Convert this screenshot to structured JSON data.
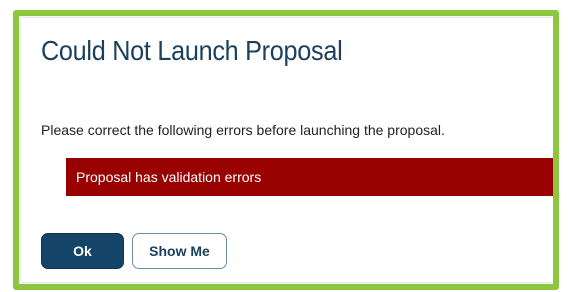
{
  "dialog": {
    "title": "Could Not Launch Proposal",
    "message": "Please correct the following errors before launching the proposal.",
    "error": "Proposal has validation errors",
    "ok_label": "Ok",
    "show_me_label": "Show Me"
  },
  "colors": {
    "highlight_border": "#8dc63f",
    "title": "#1b3f5c",
    "error_banner": "#990000",
    "primary_button": "#144468"
  }
}
